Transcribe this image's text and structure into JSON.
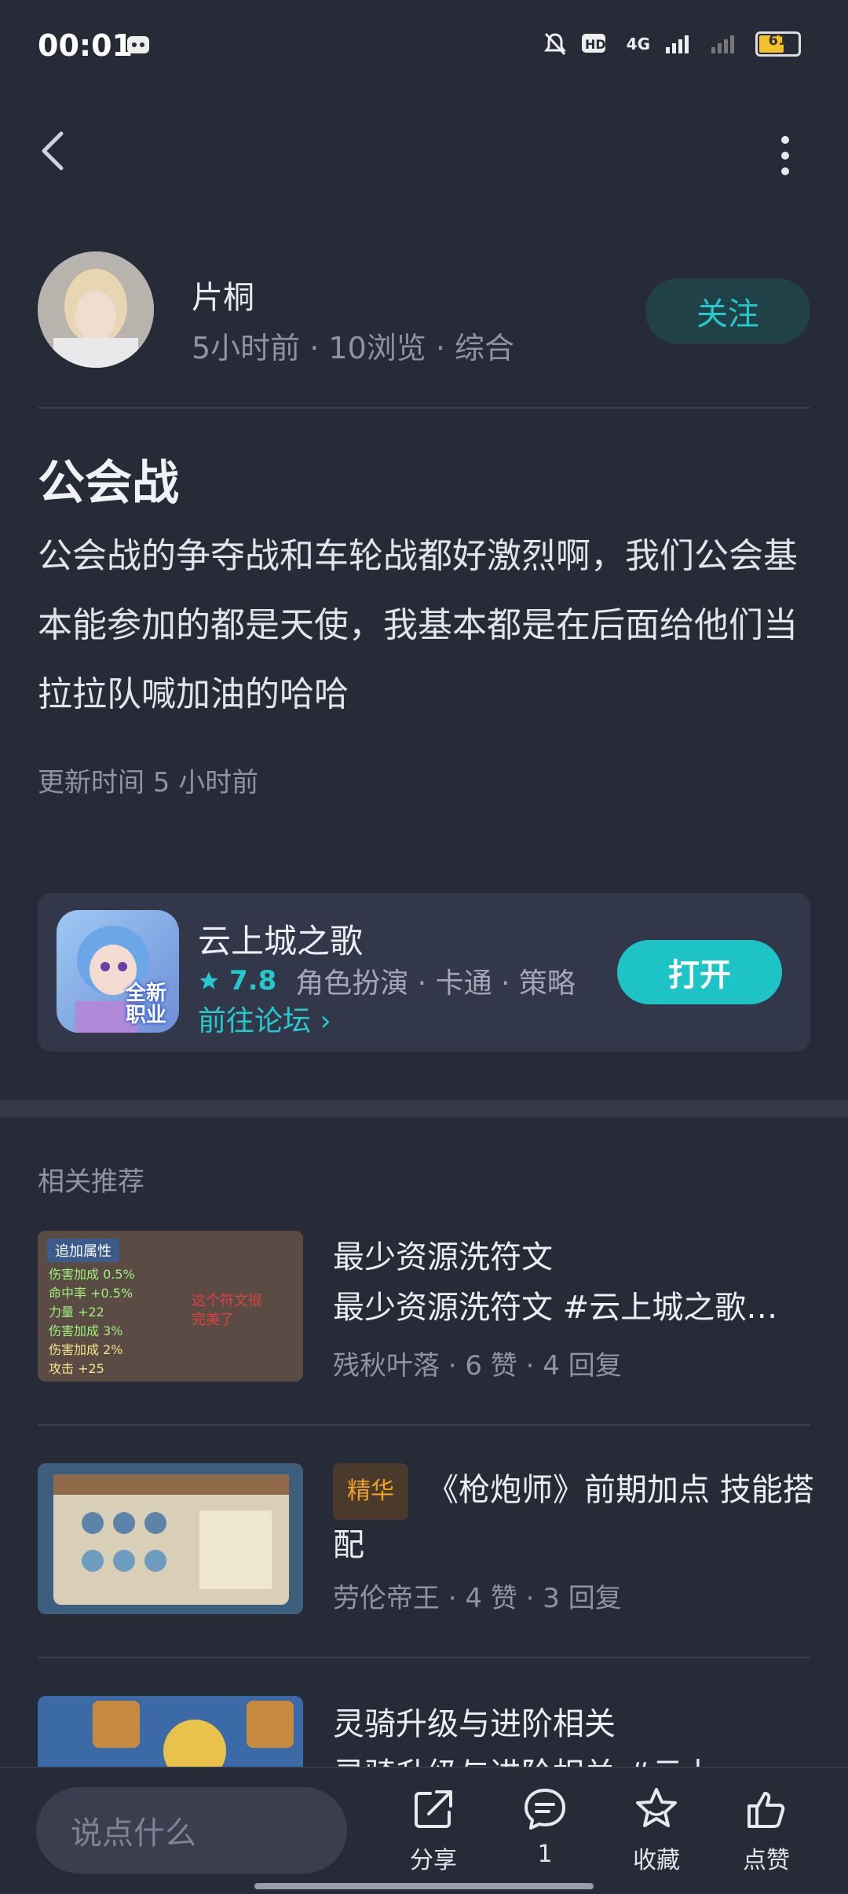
{
  "status_bar": {
    "time": "00:01",
    "network": "4G",
    "battery": "61"
  },
  "author": {
    "name": "片桐",
    "meta": "5小时前 · 10浏览 · 综合",
    "follow_label": "关注"
  },
  "post": {
    "title": "公会战",
    "body": "公会战的争夺战和车轮战都好激烈啊，我们公会基本能参加的都是天使，我基本都是在后面给他们当拉拉队喊加油的哈哈",
    "updated": "更新时间 5 小时前"
  },
  "game_card": {
    "name": "云上城之歌",
    "rating": "7.8",
    "tags": "角色扮演 · 卡通 · 策略",
    "forum_link": "前往论坛 ›",
    "open_label": "打开",
    "icon_text": "全新职业"
  },
  "related": {
    "title": "相关推荐",
    "items": [
      {
        "title_line1": "最少资源洗符文",
        "title_line2": "最少资源洗符文 #云上城之歌…",
        "meta": "残秋叶落 · 6 赞 · 4 回复",
        "thumb": {
          "header": "追加属性",
          "lines": [
            "伤害加成 0.5%",
            "命中率 +0.5%",
            "力量 +22",
            "伤害加成 3%",
            "伤害加成 2%",
            "攻击 +25"
          ],
          "note": "这个符文很完美了"
        }
      },
      {
        "badge": "精华",
        "title": "《枪炮师》前期加点 技能搭配",
        "meta": "劳伦帝王 · 4 赞 · 3 回复"
      },
      {
        "title_line1": "灵骑升级与进阶相关",
        "title_line2": "灵骑升级与进阶相关 #云上"
      }
    ]
  },
  "bottom_bar": {
    "input_placeholder": "说点什么",
    "share_label": "分享",
    "comment_count": "1",
    "favorite_label": "收藏",
    "like_label": "点赞"
  }
}
